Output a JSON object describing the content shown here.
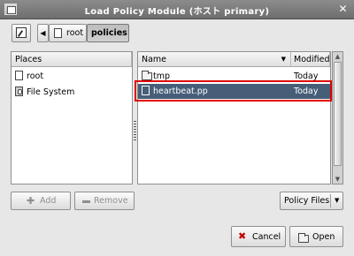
{
  "window": {
    "title": "Load Policy Module (ホスト primary)"
  },
  "path": {
    "root_label": "root",
    "current_label": "policies"
  },
  "places": {
    "header": "Places",
    "items": [
      {
        "label": "root",
        "icon": "document-icon"
      },
      {
        "label": "File System",
        "icon": "drive-icon"
      }
    ]
  },
  "files": {
    "columns": {
      "name": "Name",
      "modified": "Modified"
    },
    "rows": [
      {
        "name": "tmp",
        "modified": "Today",
        "icon": "folder-icon",
        "selected": false
      },
      {
        "name": "heartbeat.pp",
        "modified": "Today",
        "icon": "file-icon",
        "selected": true
      }
    ]
  },
  "buttons": {
    "add": "Add",
    "remove": "Remove",
    "filter": "Policy Files",
    "cancel": "Cancel",
    "open": "Open"
  },
  "colors": {
    "selection": "#465e78",
    "highlight_border": "#e00000"
  }
}
